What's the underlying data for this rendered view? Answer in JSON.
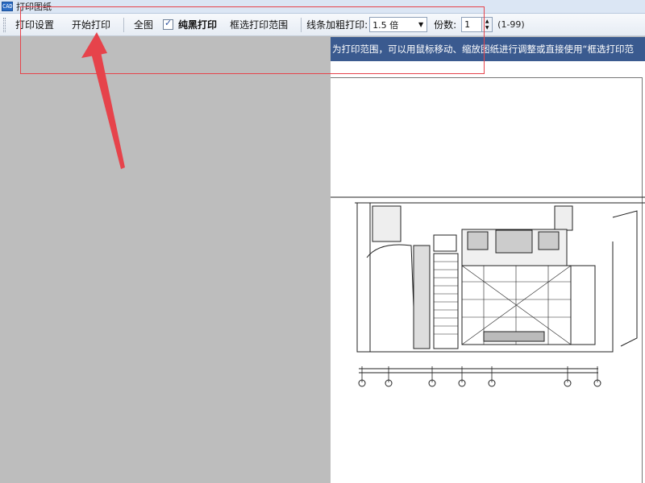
{
  "window": {
    "title": "打印图纸",
    "icon_text": "CAD"
  },
  "toolbar": {
    "print_settings": "打印设置",
    "start_print": "开始打印",
    "full_view": "全图",
    "black_print_label": "纯黑打印",
    "black_print_checked": true,
    "select_range": "框选打印范围",
    "line_thicken_label": "线条加粗打印:",
    "line_thicken_value": "1.5 倍",
    "copies_label": "份数:",
    "copies_value": "1",
    "copies_range": "(1-99)"
  },
  "banner": {
    "text": "为打印范围，可以用鼠标移动、缩放图纸进行调整或直接使用“框选打印范"
  },
  "colors": {
    "annotation_red": "#e6434b",
    "banner_bg": "#3a5a8f",
    "gray_bg": "#bdbdbd"
  }
}
